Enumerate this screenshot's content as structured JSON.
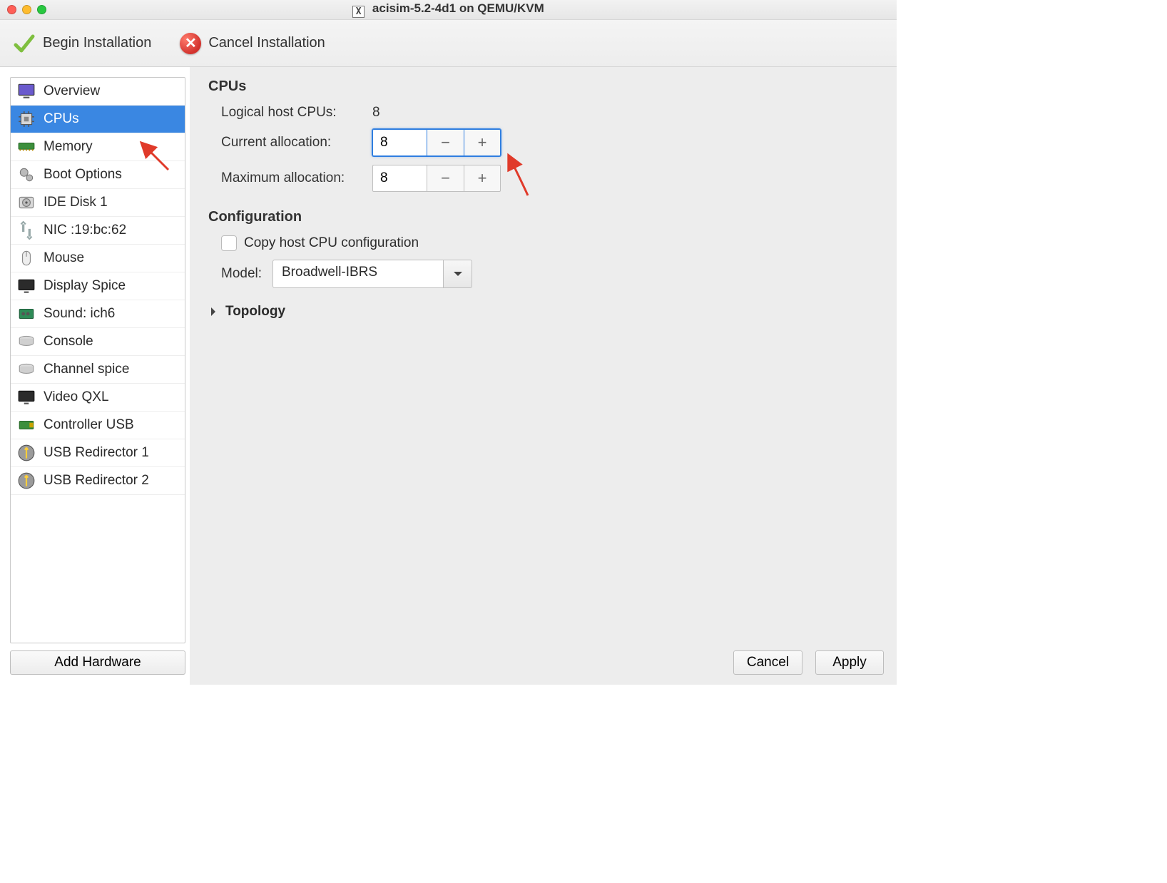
{
  "window": {
    "title": "acisim-5.2-4d1 on QEMU/KVM"
  },
  "toolbar": {
    "begin": "Begin Installation",
    "cancel": "Cancel Installation"
  },
  "sidebar": {
    "items": [
      {
        "label": "Overview",
        "icon": "monitor"
      },
      {
        "label": "CPUs",
        "icon": "cpu",
        "selected": true
      },
      {
        "label": "Memory",
        "icon": "ram"
      },
      {
        "label": "Boot Options",
        "icon": "gears"
      },
      {
        "label": "IDE Disk 1",
        "icon": "disk"
      },
      {
        "label": "NIC :19:bc:62",
        "icon": "nic"
      },
      {
        "label": "Mouse",
        "icon": "mouse"
      },
      {
        "label": "Display Spice",
        "icon": "display"
      },
      {
        "label": "Sound: ich6",
        "icon": "sound"
      },
      {
        "label": "Console",
        "icon": "console"
      },
      {
        "label": "Channel spice",
        "icon": "console"
      },
      {
        "label": "Video QXL",
        "icon": "display"
      },
      {
        "label": "Controller USB",
        "icon": "usb"
      },
      {
        "label": "USB Redirector 1",
        "icon": "usb-round"
      },
      {
        "label": "USB Redirector 2",
        "icon": "usb-round"
      }
    ],
    "add_hw": "Add Hardware"
  },
  "cpus": {
    "heading": "CPUs",
    "logical_label": "Logical host CPUs:",
    "logical_value": "8",
    "current_label": "Current allocation:",
    "current_value": "8",
    "max_label": "Maximum allocation:",
    "max_value": "8"
  },
  "config": {
    "heading": "Configuration",
    "copy_host_label": "Copy host CPU configuration",
    "model_label": "Model:",
    "model_value": "Broadwell-IBRS"
  },
  "topology": {
    "heading": "Topology"
  },
  "footer": {
    "cancel": "Cancel",
    "apply": "Apply"
  }
}
